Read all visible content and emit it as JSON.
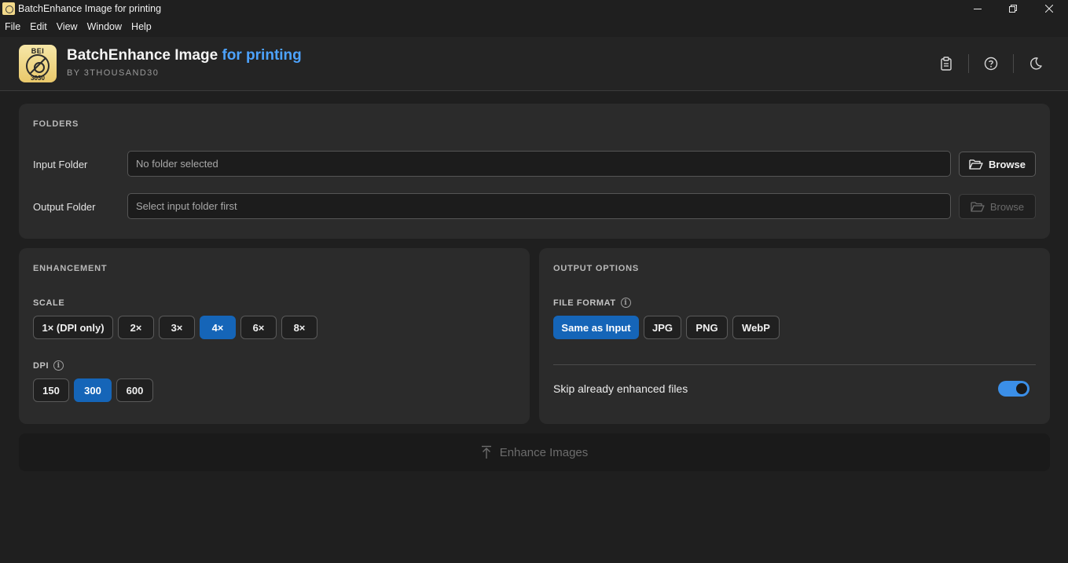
{
  "window": {
    "title": "BatchEnhance Image for printing",
    "controls": {
      "minimize": "minimize-icon",
      "restore": "restore-icon",
      "close": "close-icon"
    }
  },
  "menu": [
    "File",
    "Edit",
    "View",
    "Window",
    "Help"
  ],
  "header": {
    "logo_text_top": "BEI",
    "logo_text_bottom": "3030",
    "title_main": "BatchEnhance Image",
    "title_accent": "for printing",
    "subtitle": "BY 3THOUSAND30",
    "actions": [
      "clipboard-icon",
      "help-circle-icon",
      "moon-icon"
    ],
    "accent_color": "#4da3ff"
  },
  "folders": {
    "section_title": "FOLDERS",
    "input_label": "Input Folder",
    "input_placeholder": "No folder selected",
    "input_value": "",
    "output_label": "Output Folder",
    "output_placeholder": "Select input folder first",
    "output_value": "",
    "browse_label": "Browse"
  },
  "enhancement": {
    "section_title": "ENHANCEMENT",
    "scale_label": "SCALE",
    "scale_options": [
      "1× (DPI only)",
      "2×",
      "3×",
      "4×",
      "6×",
      "8×"
    ],
    "scale_selected": "4×",
    "dpi_label": "DPI",
    "dpi_options": [
      "150",
      "300",
      "600"
    ],
    "dpi_selected": "300"
  },
  "output_options": {
    "section_title": "OUTPUT OPTIONS",
    "format_label": "FILE FORMAT",
    "format_options": [
      "Same as Input",
      "JPG",
      "PNG",
      "WebP"
    ],
    "format_selected": "Same as Input",
    "skip_label": "Skip already enhanced files",
    "skip_enabled": true
  },
  "action": {
    "enhance_label": "Enhance Images",
    "enhance_icon": "arrow-up-bar-icon"
  },
  "colors": {
    "active": "#1565b8",
    "toggle_on": "#3b8fe8"
  }
}
